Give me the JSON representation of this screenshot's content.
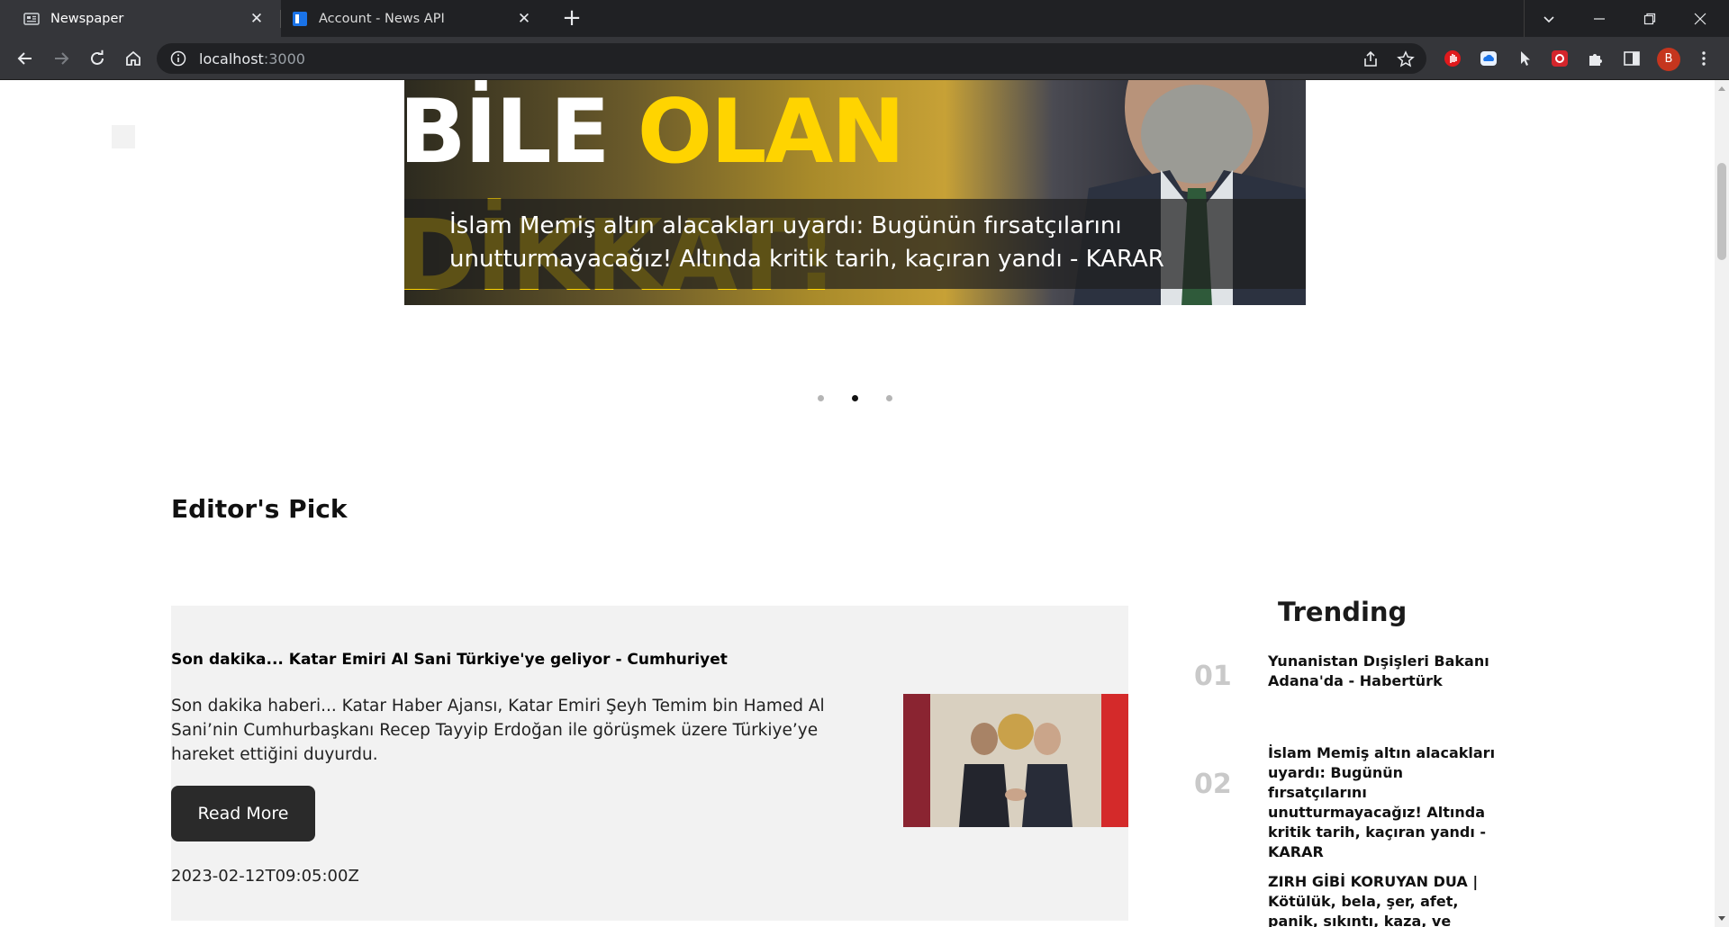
{
  "browser": {
    "tabs": [
      {
        "title": "Newspaper",
        "active": true,
        "icon": "newspaper-icon"
      },
      {
        "title": "Account - News API",
        "active": false,
        "icon": "newsapi-icon"
      }
    ],
    "address": {
      "host": "localhost",
      "port": ":3000"
    },
    "profile_initial": "B",
    "accent": "#c5351e"
  },
  "hero": {
    "slogan_white": "BİLE",
    "slogan_yellow": "OLAN",
    "slogan_bottom": "DİKKAT!",
    "caption": "İslam Memiş altın alacakları uyardı: Bugünün fırsatçılarını unutturmayacağız! Altında kritik tarih, kaçıran yandı - KARAR",
    "carousel": {
      "count": 3,
      "active_index": 1
    }
  },
  "editors_pick": {
    "heading": "Editor's Pick",
    "article": {
      "title": "Son dakika... Katar Emiri Al Sani Türkiye'ye geliyor - Cumhuriyet",
      "description": "Son dakika haberi... Katar Haber Ajansı, Katar Emiri Şeyh Temim bin Hamed Al Sani’nin Cumhurbaşkanı Recep Tayyip Erdoğan ile görüşmek üzere Türkiye’ye hareket ettiğini duyurdu.",
      "button": "Read More",
      "date": "2023-02-12T09:05:00Z"
    }
  },
  "trending": {
    "heading": "Trending",
    "items": [
      {
        "num": "01",
        "text": "Yunanistan Dışişleri Bakanı Adana'da - Habertürk"
      },
      {
        "num": "02",
        "text": "İslam Memiş altın alacakları uyardı: Bugünün fırsatçılarını unutturmayacağız! Altında kritik tarih, kaçıran yandı - KARAR"
      },
      {
        "num": "",
        "text": "ZIRH GİBİ KORUYAN DUA | Kötülük, bela, şer, afet, panik, sıkıntı, kaza, ve korkudan kalkan"
      }
    ]
  }
}
